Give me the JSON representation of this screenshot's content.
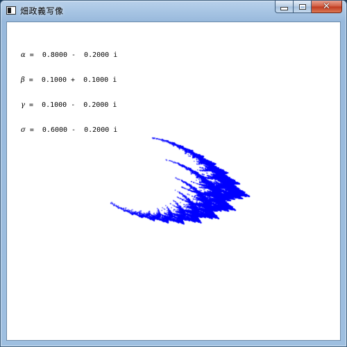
{
  "window": {
    "title": "畑政義写像",
    "buttons": {
      "minimize": "minimize",
      "maximize": "maximize",
      "close": "close"
    },
    "icon": "window-app-icon"
  },
  "parameters": [
    {
      "symbol": "α",
      "text": " =  0.8000 -  0.2000 i"
    },
    {
      "symbol": "β",
      "text": " =  0.1000 +  0.1000 i"
    },
    {
      "symbol": "γ",
      "text": " =  0.1000 -  0.2000 i"
    },
    {
      "symbol": "σ",
      "text": " =  0.6000 -  0.2000 i"
    }
  ],
  "fractal": {
    "color": "#0000ff",
    "alpha": [
      0.8,
      -0.2
    ],
    "beta": [
      0.1,
      0.1
    ],
    "gamma": [
      0.1,
      -0.2
    ],
    "sigma": [
      0.6,
      -0.2
    ]
  },
  "colors": {
    "fractal": "#0000ff",
    "background": "#ffffff",
    "close_button": "#c0391f"
  }
}
